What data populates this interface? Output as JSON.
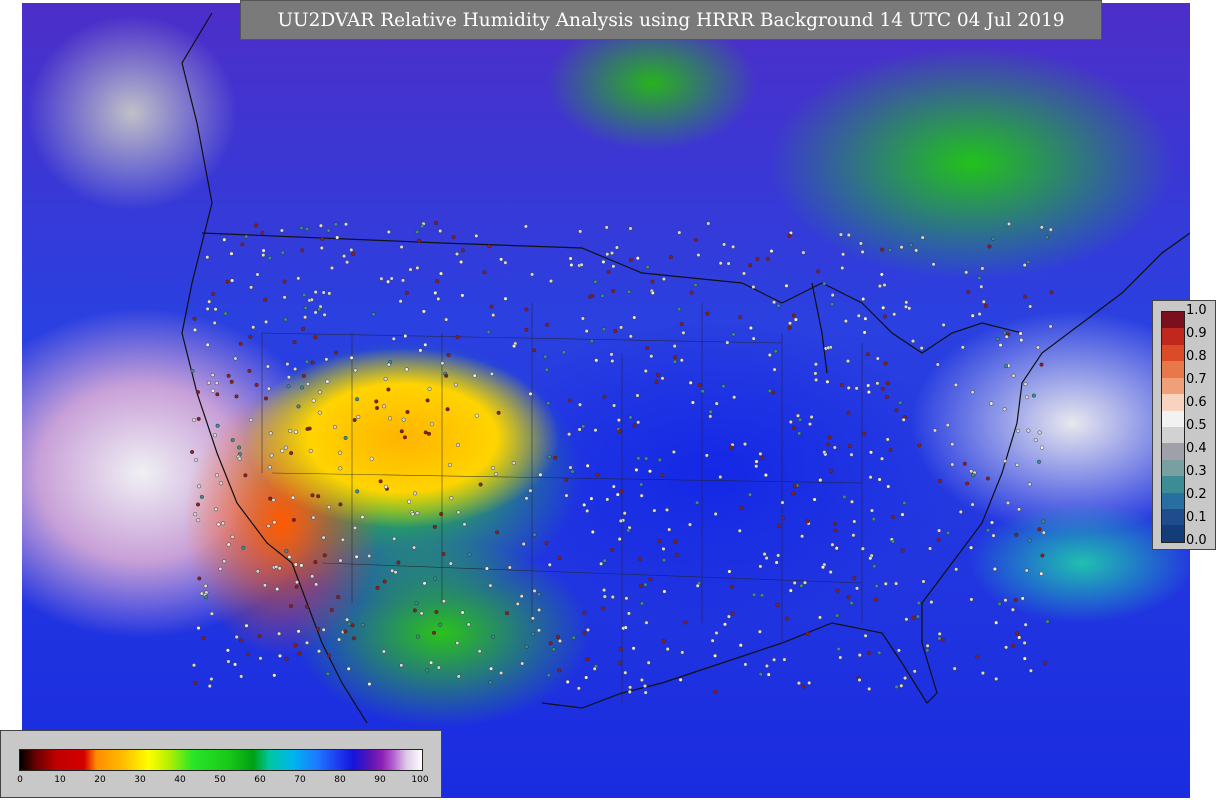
{
  "title": "UU2DVAR Relative Humidity Analysis using HRRR Background 14 UTC 04 Jul 2019",
  "map": {
    "description_layers": [
      "relative-humidity-field",
      "coastlines",
      "state-borders",
      "observation-stations"
    ]
  },
  "legend_right": {
    "colors": [
      "#7a0f1e",
      "#c0281e",
      "#dc4b28",
      "#e8784a",
      "#f0a078",
      "#f8d4c0",
      "#f2f2f2",
      "#d2d2d2",
      "#a0a0a8",
      "#78a0a0",
      "#3c8c96",
      "#286ea0",
      "#1e4c8c",
      "#143c78"
    ],
    "ticks": [
      "1.0",
      "0.9",
      "0.8",
      "0.7",
      "0.6",
      "0.5",
      "0.4",
      "0.3",
      "0.2",
      "0.1",
      "0.0"
    ]
  },
  "legend_bottom": {
    "ticks": [
      "0",
      "10",
      "20",
      "30",
      "40",
      "50",
      "60",
      "70",
      "80",
      "90",
      "100"
    ]
  }
}
